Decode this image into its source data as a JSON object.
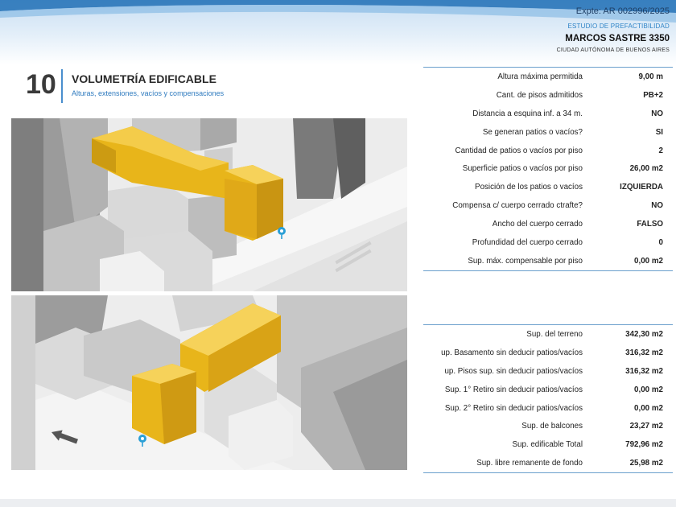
{
  "header": {
    "expte": "Expte: AR 002996/2025",
    "estudio": "ESTUDIO DE PREFACTIBILIDAD",
    "address": "MARCOS SASTRE 3350",
    "city": "CIUDAD AUTÓNOMA DE BUENOS AIRES"
  },
  "section": {
    "number": "10",
    "title": "VOLUMETRÍA EDIFICABLE",
    "subtitle": "Alturas, extensiones, vacíos y compensaciones"
  },
  "table1": [
    {
      "label": "Altura máxima permitida",
      "value": "9,00 m"
    },
    {
      "label": "Cant. de pisos admitidos",
      "value": "PB+2"
    },
    {
      "label": "Distancia a esquina inf. a 34 m.",
      "value": "NO"
    },
    {
      "label": "Se generan patios o vacíos?",
      "value": "SI"
    },
    {
      "label": "Cantidad de patios o vacíos por piso",
      "value": "2"
    },
    {
      "label": "Superficie patios o vacíos por piso",
      "value": "26,00 m2"
    },
    {
      "label": "Posición de los patios o vacíos",
      "value": "IZQUIERDA"
    },
    {
      "label": "Compensa c/ cuerpo cerrado ctrafte?",
      "value": "NO"
    },
    {
      "label": "Ancho del  cuerpo cerrado",
      "value": "FALSO"
    },
    {
      "label": "Profundidad del  cuerpo cerrado",
      "value": "0"
    },
    {
      "label": "Sup. máx. compensable por piso",
      "value": "0,00 m2"
    }
  ],
  "table2": [
    {
      "label": "Sup. del terreno",
      "value": "342,30 m2"
    },
    {
      "label": "up. Basamento sin deducir patios/vacíos",
      "value": "316,32 m2"
    },
    {
      "label": "up. Pisos sup. sin deducir patios/vacíos",
      "value": "316,32 m2"
    },
    {
      "label": "Sup. 1° Retiro sin deducir patios/vacíos",
      "value": "0,00 m2"
    },
    {
      "label": "Sup. 2° Retiro sin deducir patios/vacíos",
      "value": "0,00 m2"
    },
    {
      "label": "Sup. de balcones",
      "value": "23,27 m2"
    },
    {
      "label": "Sup. edificable Total",
      "value": "792,96 m2"
    },
    {
      "label": "Sup. libre remanente de fondo",
      "value": "25,98 m2"
    }
  ],
  "colors": {
    "accent_blue": "#2f7bbf",
    "volume_yellow": "#e8b51a",
    "table_rule": "#6a9fcc"
  },
  "icons": {
    "map_pin": "map-pin-icon",
    "direction_arrow": "arrow-left-icon"
  }
}
